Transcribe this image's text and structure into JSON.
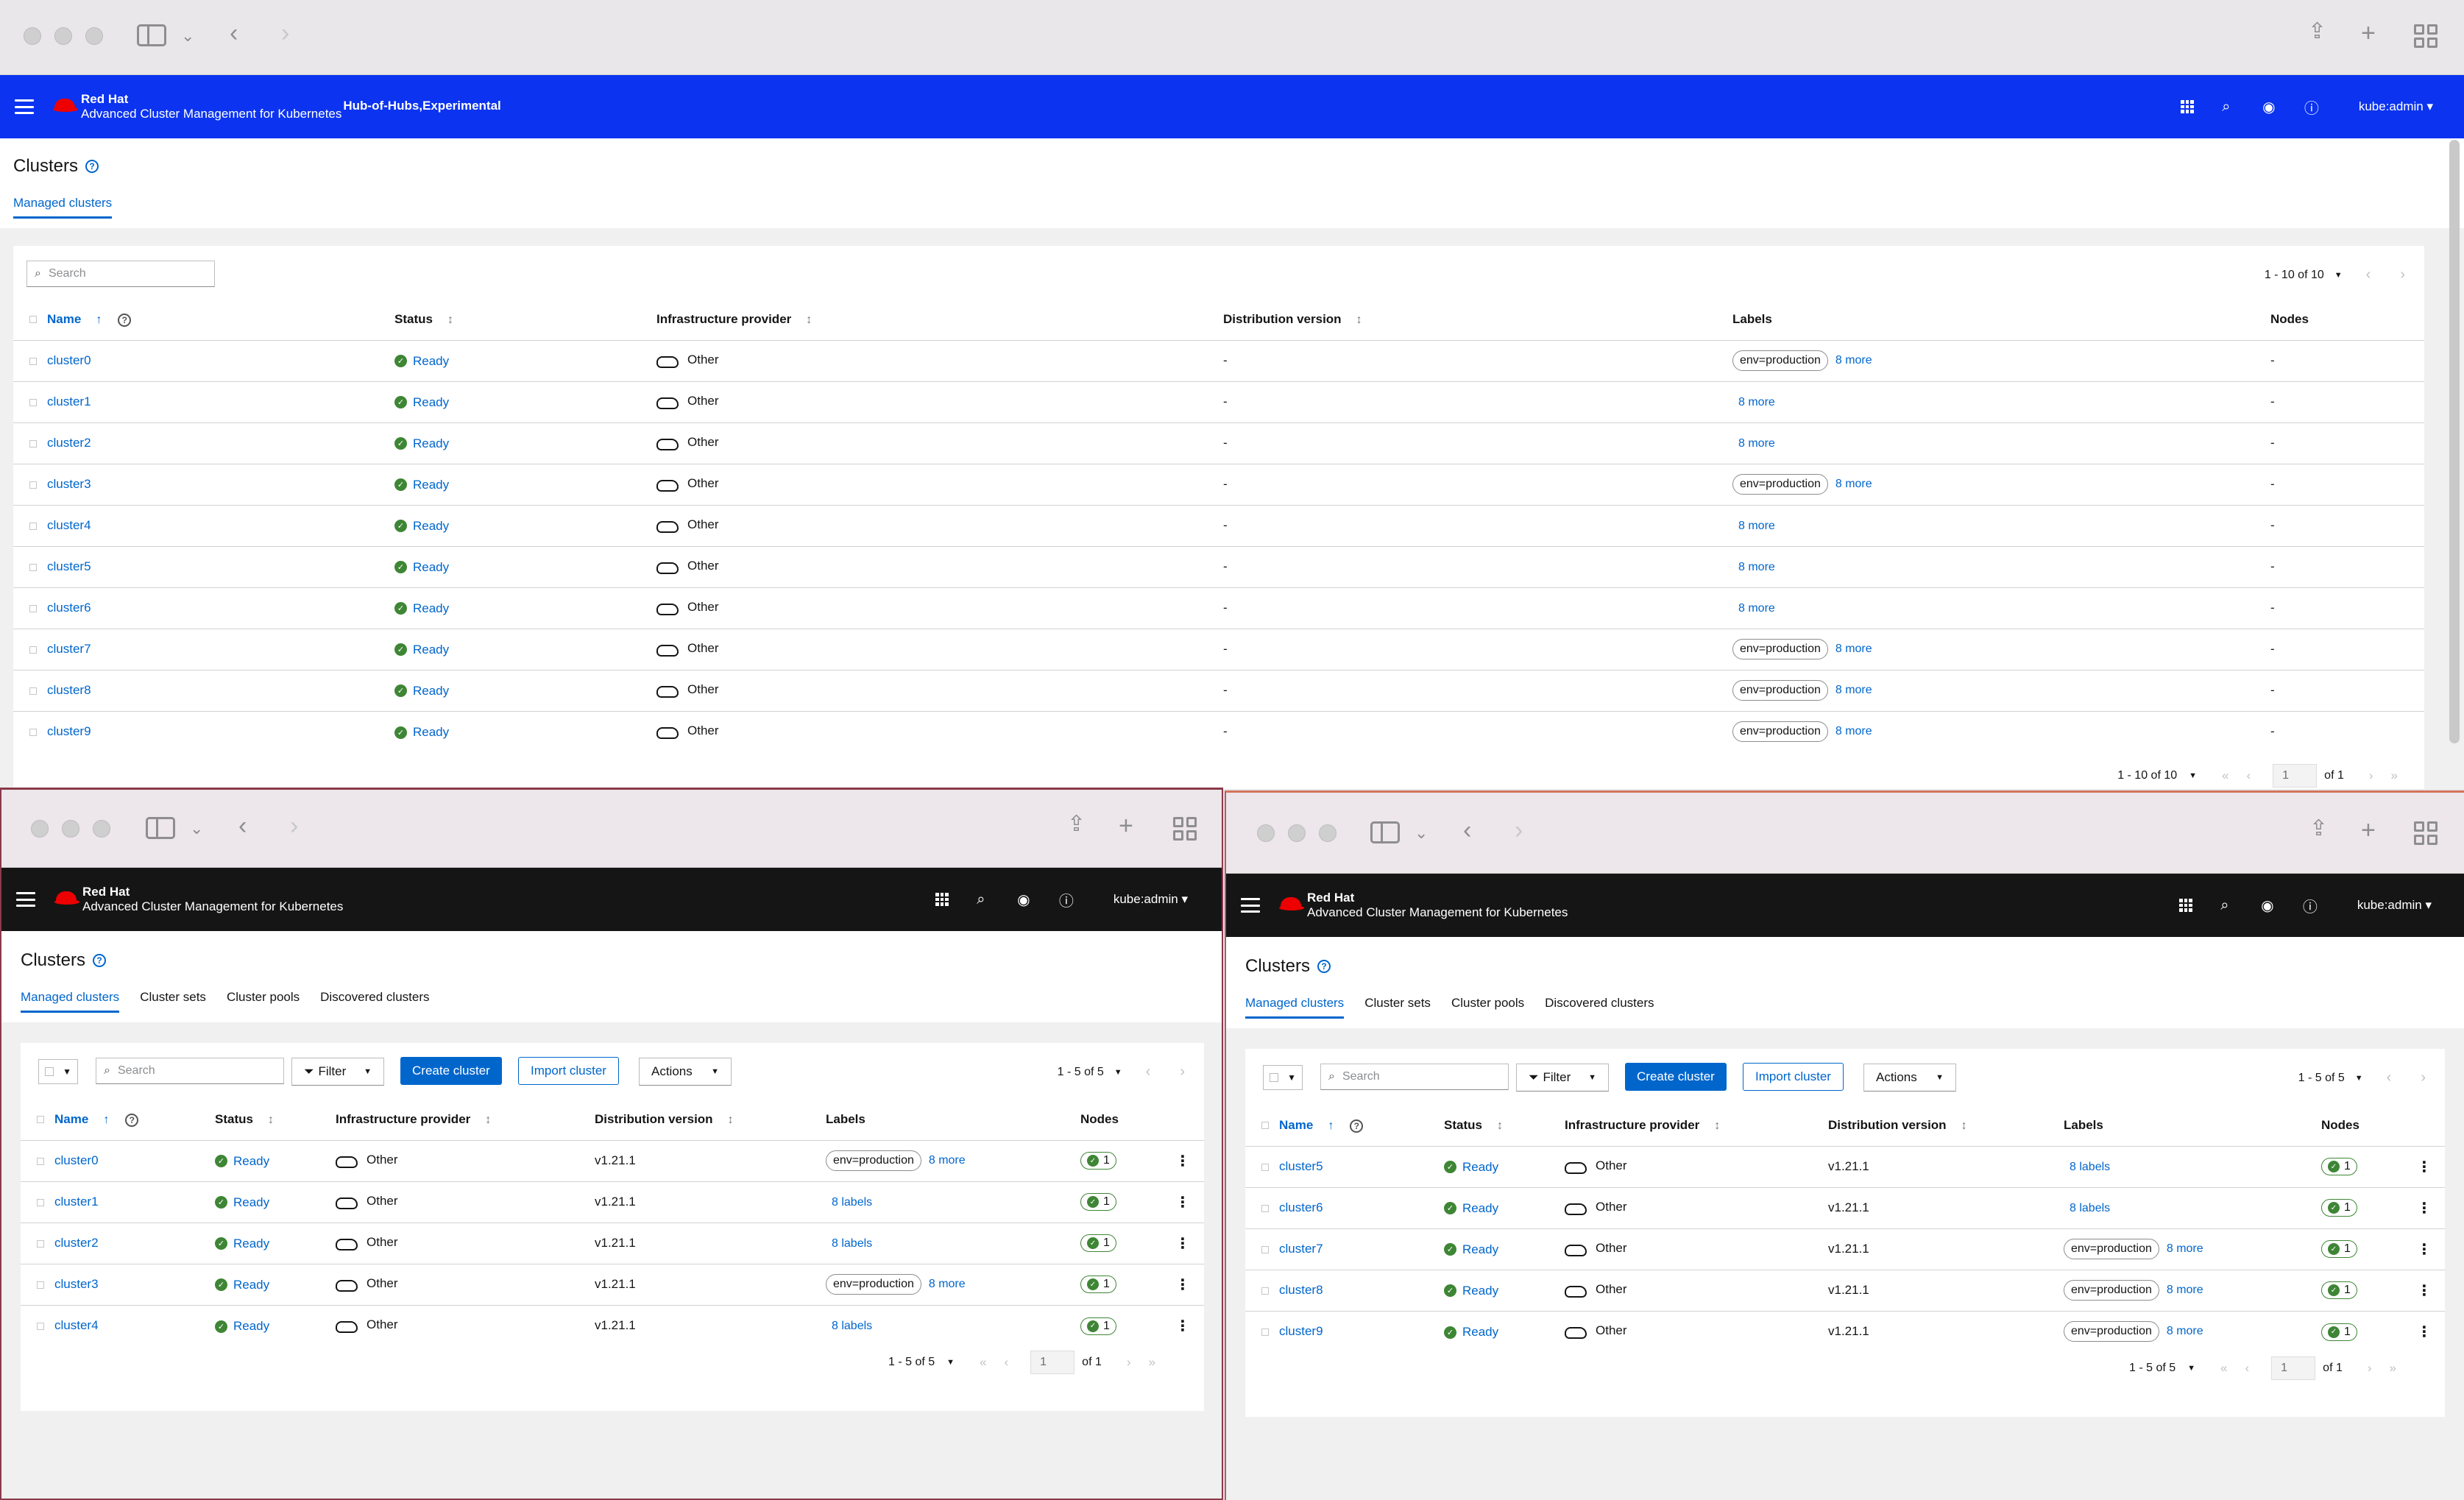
{
  "top_window": {
    "masthead": {
      "brand_line1": "Red Hat",
      "brand_line2": "Advanced Cluster Management for Kubernetes",
      "hub_label": "Hub-of-Hubs,Experimental",
      "user": "kube:admin ▾"
    },
    "page_title": "Clusters",
    "tabs": [
      "Managed clusters"
    ],
    "search_placeholder": "Search",
    "pagination_top": "1 - 10 of 10",
    "columns": [
      "Name",
      "Status",
      "Infrastructure provider",
      "Distribution version",
      "Labels",
      "Nodes"
    ],
    "rows": [
      {
        "name": "cluster0",
        "status": "Ready",
        "provider": "Other",
        "version": "-",
        "label": "env=production",
        "more": "8 more",
        "nodes": "-"
      },
      {
        "name": "cluster1",
        "status": "Ready",
        "provider": "Other",
        "version": "-",
        "label": "",
        "more": "8 more",
        "nodes": "-"
      },
      {
        "name": "cluster2",
        "status": "Ready",
        "provider": "Other",
        "version": "-",
        "label": "",
        "more": "8 more",
        "nodes": "-"
      },
      {
        "name": "cluster3",
        "status": "Ready",
        "provider": "Other",
        "version": "-",
        "label": "env=production",
        "more": "8 more",
        "nodes": "-"
      },
      {
        "name": "cluster4",
        "status": "Ready",
        "provider": "Other",
        "version": "-",
        "label": "",
        "more": "8 more",
        "nodes": "-"
      },
      {
        "name": "cluster5",
        "status": "Ready",
        "provider": "Other",
        "version": "-",
        "label": "",
        "more": "8 more",
        "nodes": "-"
      },
      {
        "name": "cluster6",
        "status": "Ready",
        "provider": "Other",
        "version": "-",
        "label": "",
        "more": "8 more",
        "nodes": "-"
      },
      {
        "name": "cluster7",
        "status": "Ready",
        "provider": "Other",
        "version": "-",
        "label": "env=production",
        "more": "8 more",
        "nodes": "-"
      },
      {
        "name": "cluster8",
        "status": "Ready",
        "provider": "Other",
        "version": "-",
        "label": "env=production",
        "more": "8 more",
        "nodes": "-"
      },
      {
        "name": "cluster9",
        "status": "Ready",
        "provider": "Other",
        "version": "-",
        "label": "env=production",
        "more": "8 more",
        "nodes": "-"
      }
    ],
    "pagination_bottom": {
      "range": "1 - 10 of 10",
      "page": "1",
      "of": "of 1"
    }
  },
  "bottom_left_window": {
    "masthead": {
      "brand_line1": "Red Hat",
      "brand_line2": "Advanced Cluster Management for Kubernetes",
      "user": "kube:admin ▾"
    },
    "page_title": "Clusters",
    "tabs": [
      "Managed clusters",
      "Cluster sets",
      "Cluster pools",
      "Discovered clusters"
    ],
    "search_placeholder": "Search",
    "filter_label": "Filter",
    "create_label": "Create cluster",
    "import_label": "Import cluster",
    "actions_label": "Actions",
    "pagination_top": "1 - 5 of 5",
    "columns": [
      "Name",
      "Status",
      "Infrastructure provider",
      "Distribution version",
      "Labels",
      "Nodes"
    ],
    "rows": [
      {
        "name": "cluster0",
        "status": "Ready",
        "provider": "Other",
        "version": "v1.21.1",
        "label": "env=production",
        "more": "8 more",
        "nodes": "1"
      },
      {
        "name": "cluster1",
        "status": "Ready",
        "provider": "Other",
        "version": "v1.21.1",
        "label": "",
        "more": "8 labels",
        "nodes": "1"
      },
      {
        "name": "cluster2",
        "status": "Ready",
        "provider": "Other",
        "version": "v1.21.1",
        "label": "",
        "more": "8 labels",
        "nodes": "1"
      },
      {
        "name": "cluster3",
        "status": "Ready",
        "provider": "Other",
        "version": "v1.21.1",
        "label": "env=production",
        "more": "8 more",
        "nodes": "1"
      },
      {
        "name": "cluster4",
        "status": "Ready",
        "provider": "Other",
        "version": "v1.21.1",
        "label": "",
        "more": "8 labels",
        "nodes": "1"
      }
    ],
    "pagination_bottom": {
      "range": "1 - 5 of 5",
      "page": "1",
      "of": "of 1"
    }
  },
  "bottom_right_window": {
    "masthead": {
      "brand_line1": "Red Hat",
      "brand_line2": "Advanced Cluster Management for Kubernetes",
      "user": "kube:admin ▾"
    },
    "page_title": "Clusters",
    "tabs": [
      "Managed clusters",
      "Cluster sets",
      "Cluster pools",
      "Discovered clusters"
    ],
    "search_placeholder": "Search",
    "filter_label": "Filter",
    "create_label": "Create cluster",
    "import_label": "Import cluster",
    "actions_label": "Actions",
    "pagination_top": "1 - 5 of 5",
    "columns": [
      "Name",
      "Status",
      "Infrastructure provider",
      "Distribution version",
      "Labels",
      "Nodes"
    ],
    "rows": [
      {
        "name": "cluster5",
        "status": "Ready",
        "provider": "Other",
        "version": "v1.21.1",
        "label": "",
        "more": "8 labels",
        "nodes": "1"
      },
      {
        "name": "cluster6",
        "status": "Ready",
        "provider": "Other",
        "version": "v1.21.1",
        "label": "",
        "more": "8 labels",
        "nodes": "1"
      },
      {
        "name": "cluster7",
        "status": "Ready",
        "provider": "Other",
        "version": "v1.21.1",
        "label": "env=production",
        "more": "8 more",
        "nodes": "1"
      },
      {
        "name": "cluster8",
        "status": "Ready",
        "provider": "Other",
        "version": "v1.21.1",
        "label": "env=production",
        "more": "8 more",
        "nodes": "1"
      },
      {
        "name": "cluster9",
        "status": "Ready",
        "provider": "Other",
        "version": "v1.21.1",
        "label": "env=production",
        "more": "8 more",
        "nodes": "1"
      }
    ],
    "pagination_bottom": {
      "range": "1 - 5 of 5",
      "page": "1",
      "of": "of 1"
    }
  },
  "colors": {
    "masthead_blue": "#0b33f0",
    "masthead_dark": "#151515",
    "link": "#0066cc",
    "ready_green": "#3e8635"
  }
}
